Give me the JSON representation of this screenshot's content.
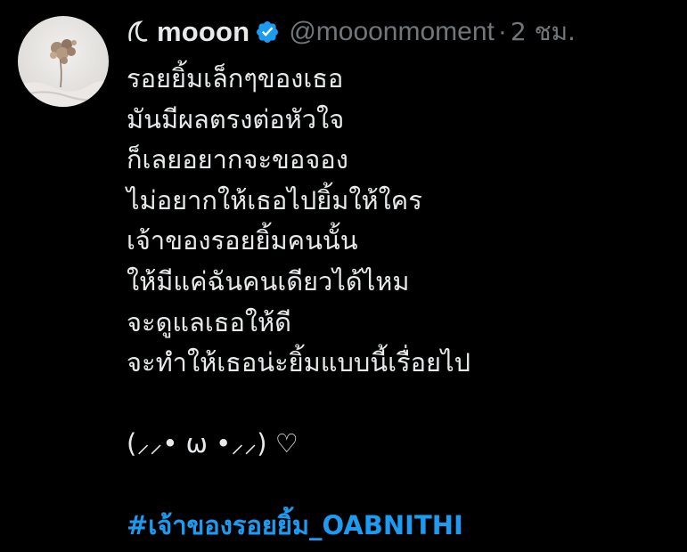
{
  "tweet": {
    "author": {
      "display_name": "mooon",
      "name_prefix_icon": "crescent-moon-icon",
      "verified_icon": "verified-badge-icon",
      "handle": "@mooonmoment",
      "separator": "·",
      "timestamp": "2 ชม."
    },
    "avatar": {
      "description_icon": "avatar"
    },
    "lines": [
      "รอยยิ้มเล็กๆของเธอ",
      "มันมีผลตรงต่อหัวใจ",
      "ก็เลยอยากจะขอจอง",
      "ไม่อยากให้เธอไปยิ้มให้ใคร",
      "เจ้าของรอยยิ้มคนนั้น",
      "ให้มีแค่ฉันคนเดียวได้ไหม",
      "จะดูแลเธอให้ดี",
      "จะทำให้เธอน่ะยิ้มแบบนี้เรื่อยไป"
    ],
    "emoticon": "(⸝⸝• ω •⸝⸝) ♡",
    "hashtag": "#เจ้าของรอยยิ้ม_OABNITHI"
  },
  "colors": {
    "background": "#000000",
    "text": "#e7e9ea",
    "muted": "#71767b",
    "link": "#1d9bf0",
    "verified": "#1d9bf0"
  }
}
